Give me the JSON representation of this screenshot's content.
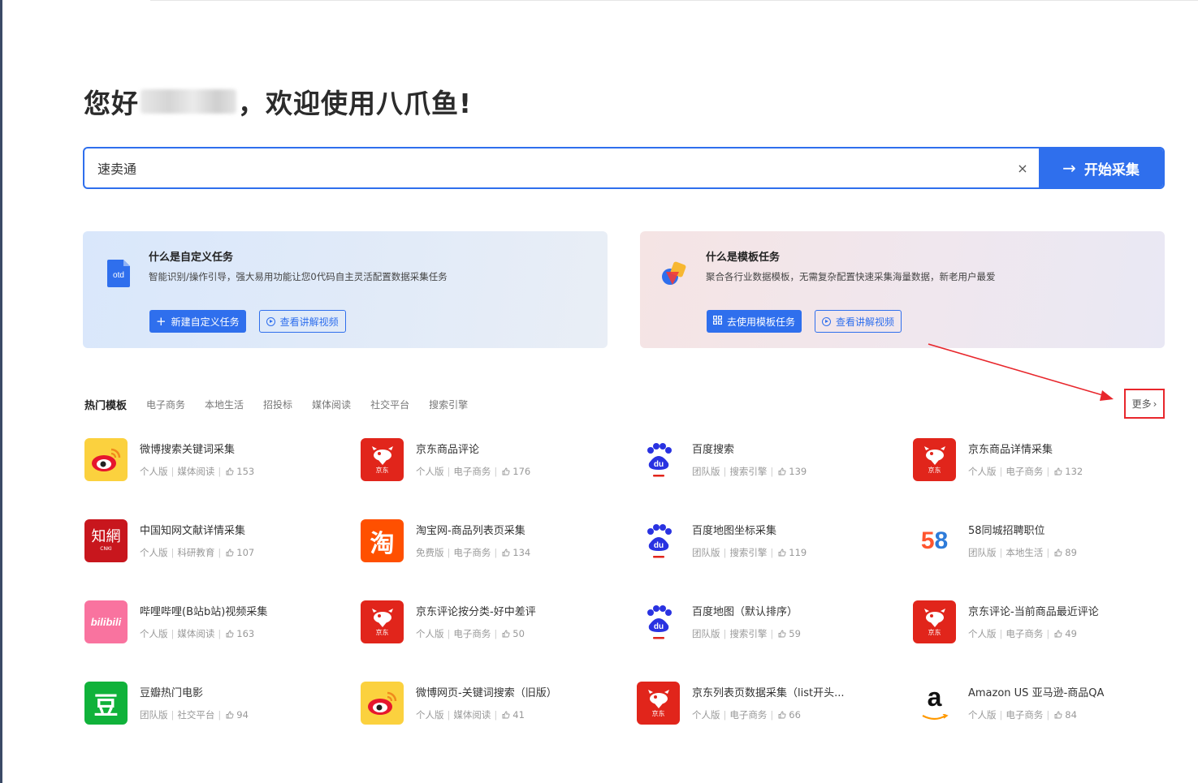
{
  "greeting": {
    "prefix": "您好",
    "suffix": "，欢迎使用八爪鱼!"
  },
  "search": {
    "value": "速卖通",
    "clear_label": "×",
    "submit_label": "开始采集"
  },
  "cards": {
    "custom": {
      "title": "什么是自定义任务",
      "desc": "智能识别/操作引导，强大易用功能让您0代码自主灵活配置数据采集任务",
      "primary_label": "新建自定义任务",
      "video_label": "查看讲解视频",
      "icon_text": "otd"
    },
    "template": {
      "title": "什么是模板任务",
      "desc": "聚合各行业数据模板，无需复杂配置快速采集海量数据，新老用户最爱",
      "primary_label": "去使用模板任务",
      "video_label": "查看讲解视频"
    }
  },
  "tabs": [
    "热门模板",
    "电子商务",
    "本地生活",
    "招投标",
    "媒体阅读",
    "社交平台",
    "搜索引擎"
  ],
  "more_label": "更多",
  "templates": [
    {
      "name": "微博搜索关键词采集",
      "edition": "个人版",
      "category": "媒体阅读",
      "likes": "153",
      "logo": "weibo"
    },
    {
      "name": "京东商品评论",
      "edition": "个人版",
      "category": "电子商务",
      "likes": "176",
      "logo": "jd"
    },
    {
      "name": "百度搜索",
      "edition": "团队版",
      "category": "搜索引擎",
      "likes": "139",
      "logo": "baidu"
    },
    {
      "name": "京东商品详情采集",
      "edition": "个人版",
      "category": "电子商务",
      "likes": "132",
      "logo": "jd"
    },
    {
      "name": "中国知网文献详情采集",
      "edition": "个人版",
      "category": "科研教育",
      "likes": "107",
      "logo": "zhiwang"
    },
    {
      "name": "淘宝网-商品列表页采集",
      "edition": "免费版",
      "category": "电子商务",
      "likes": "134",
      "logo": "taobao"
    },
    {
      "name": "百度地图坐标采集",
      "edition": "团队版",
      "category": "搜索引擎",
      "likes": "119",
      "logo": "baidu"
    },
    {
      "name": "58同城招聘职位",
      "edition": "团队版",
      "category": "本地生活",
      "likes": "89",
      "logo": "58"
    },
    {
      "name": "哔哩哔哩(B站b站)视频采集",
      "edition": "个人版",
      "category": "媒体阅读",
      "likes": "163",
      "logo": "bili"
    },
    {
      "name": "京东评论按分类-好中差评",
      "edition": "个人版",
      "category": "电子商务",
      "likes": "50",
      "logo": "jd"
    },
    {
      "name": "百度地图（默认排序）",
      "edition": "团队版",
      "category": "搜索引擎",
      "likes": "59",
      "logo": "baidu"
    },
    {
      "name": "京东评论-当前商品最近评论",
      "edition": "个人版",
      "category": "电子商务",
      "likes": "49",
      "logo": "jd"
    },
    {
      "name": "豆瓣热门电影",
      "edition": "团队版",
      "category": "社交平台",
      "likes": "94",
      "logo": "douban"
    },
    {
      "name": "微博网页-关键词搜索（旧版）",
      "edition": "个人版",
      "category": "媒体阅读",
      "likes": "41",
      "logo": "weibo"
    },
    {
      "name": "京东列表页数据采集（list开头...",
      "edition": "个人版",
      "category": "电子商务",
      "likes": "66",
      "logo": "jd"
    },
    {
      "name": "Amazon US 亚马逊-商品QA",
      "edition": "个人版",
      "category": "电子商务",
      "likes": "84",
      "logo": "amazon"
    }
  ],
  "logo_text": {
    "jd": "京东",
    "zhiwang": "知網",
    "zhiwang_sub": "CNKI",
    "taobao": "淘",
    "bili": "bilibili",
    "douban": "豆",
    "amazon": "a",
    "n58": "58",
    "baidu": "du"
  },
  "colors": {
    "accent": "#2f6fed",
    "annotation": "#e8272c"
  }
}
